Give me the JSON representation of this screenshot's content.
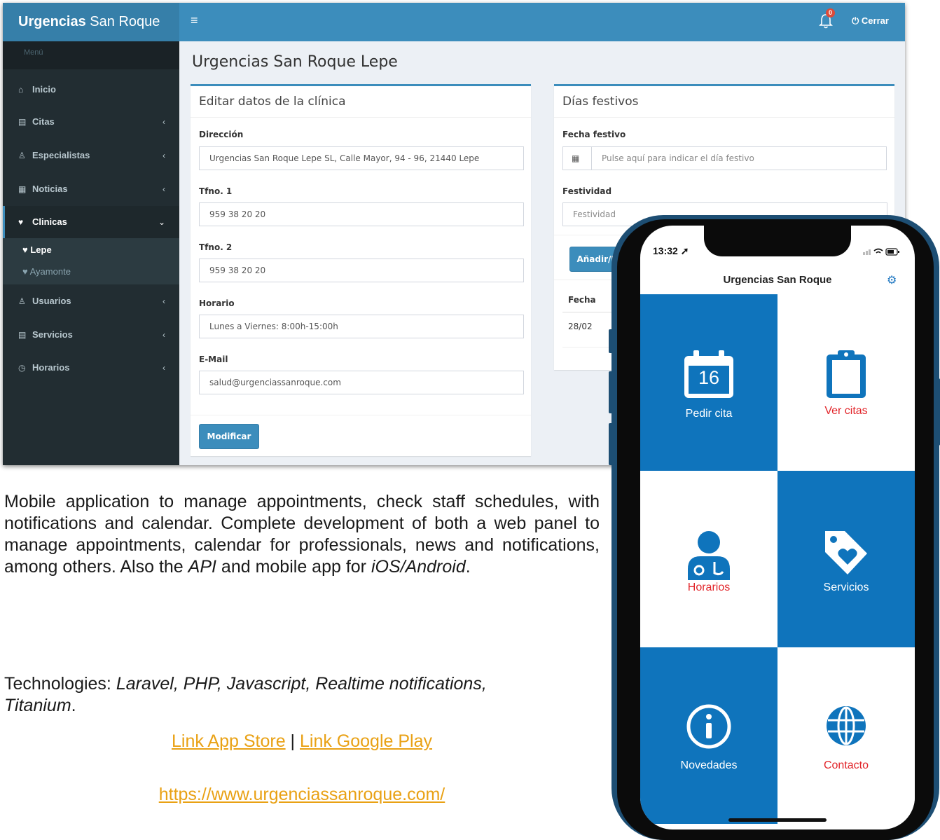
{
  "admin": {
    "logo_bold": "Urgencias",
    "logo_rest": " San Roque",
    "hamburger": "≡",
    "notification_count": "0",
    "logout_label": "Cerrar",
    "sidebar": {
      "header": "Menú",
      "items": [
        {
          "icon": "home-icon",
          "glyph": "⌂",
          "label": "Inicio",
          "has_chevron": false
        },
        {
          "icon": "calendar-card-icon",
          "glyph": "▤",
          "label": "Citas",
          "chevron": "‹"
        },
        {
          "icon": "doctor-icon",
          "glyph": "♙",
          "label": "Especialistas",
          "chevron": "‹"
        },
        {
          "icon": "news-icon",
          "glyph": "▦",
          "label": "Noticias",
          "chevron": "‹"
        },
        {
          "icon": "heartbeat-icon",
          "glyph": "♥",
          "label": "Clinicas",
          "chevron": "⌄"
        },
        {
          "icon": "user-icon",
          "glyph": "♙",
          "label": "Usuarios",
          "chevron": "‹"
        },
        {
          "icon": "services-card-icon",
          "glyph": "▤",
          "label": "Servicios",
          "chevron": "‹"
        },
        {
          "icon": "clock-icon",
          "glyph": "◷",
          "label": "Horarios",
          "chevron": "‹"
        }
      ],
      "subitems": [
        {
          "glyph": "♥",
          "label": "Lepe"
        },
        {
          "glyph": "♥",
          "label": "Ayamonte"
        }
      ]
    },
    "page_title": "Urgencias San Roque Lepe",
    "clinic_box": {
      "title": "Editar datos de la clínica",
      "fields": [
        {
          "label": "Dirección",
          "value": "Urgencias San Roque Lepe SL, Calle Mayor, 94 - 96, 21440 Lepe"
        },
        {
          "label": "Tfno. 1",
          "value": "959 38 20 20"
        },
        {
          "label": "Tfno. 2",
          "value": "959 38 20 20"
        },
        {
          "label": "Horario",
          "value": "Lunes a Viernes: 8:00h-15:00h"
        },
        {
          "label": "E-Mail",
          "value": "salud@urgenciassanroque.com"
        }
      ],
      "submit_label": "Modificar"
    },
    "holidays_box": {
      "title": "Días festivos",
      "date_label": "Fecha festivo",
      "date_placeholder": "Pulse aquí para indicar el día festivo",
      "holiday_label": "Festividad",
      "holiday_placeholder": "Festividad",
      "add_button": "Añadir/Mo",
      "table_header": "Fecha",
      "table_rows": [
        "28/02"
      ]
    }
  },
  "description": {
    "para1_a": " Mobile application to manage appointments, check staff schedules, with notifications and calendar. Complete development of both a web panel to manage appointments, calendar for professionals, news and notifications, among others. Also the ",
    "para1_api": "API",
    "para1_b": " and mobile app for ",
    "para1_platforms": "iOS/Android",
    "para1_end": ".",
    "tech_prefix": "Technologies: ",
    "tech_list": "Laravel, PHP, Javascript, Realtime notifications, Titanium",
    "tech_end": ".",
    "link_app_store": "Link App Store",
    "separator": " | ",
    "link_google_play": "Link Google Play",
    "website": "https://www.urgenciassanroque.com/"
  },
  "phone": {
    "time": "13:32 ➚",
    "app_title": "Urgencias San Roque",
    "calendar_day": "16",
    "tiles": [
      {
        "label": "Pedir cita",
        "icon": "calendar-icon",
        "style": "blue"
      },
      {
        "label": "Ver citas",
        "icon": "clipboard-icon",
        "style": "white"
      },
      {
        "label": "Horarios",
        "icon": "doctor-icon",
        "style": "white"
      },
      {
        "label": "Servicios",
        "icon": "tag-heart-icon",
        "style": "blue"
      },
      {
        "label": "Novedades",
        "icon": "info-icon",
        "style": "blue"
      },
      {
        "label": "Contacto",
        "icon": "globe-icon",
        "style": "white"
      }
    ]
  },
  "colors": {
    "brand_blue": "#3c8dbc",
    "tile_blue": "#0f74bc",
    "accent_red": "#e2262b",
    "link": "#e9a114",
    "sidebar": "#222d32"
  }
}
